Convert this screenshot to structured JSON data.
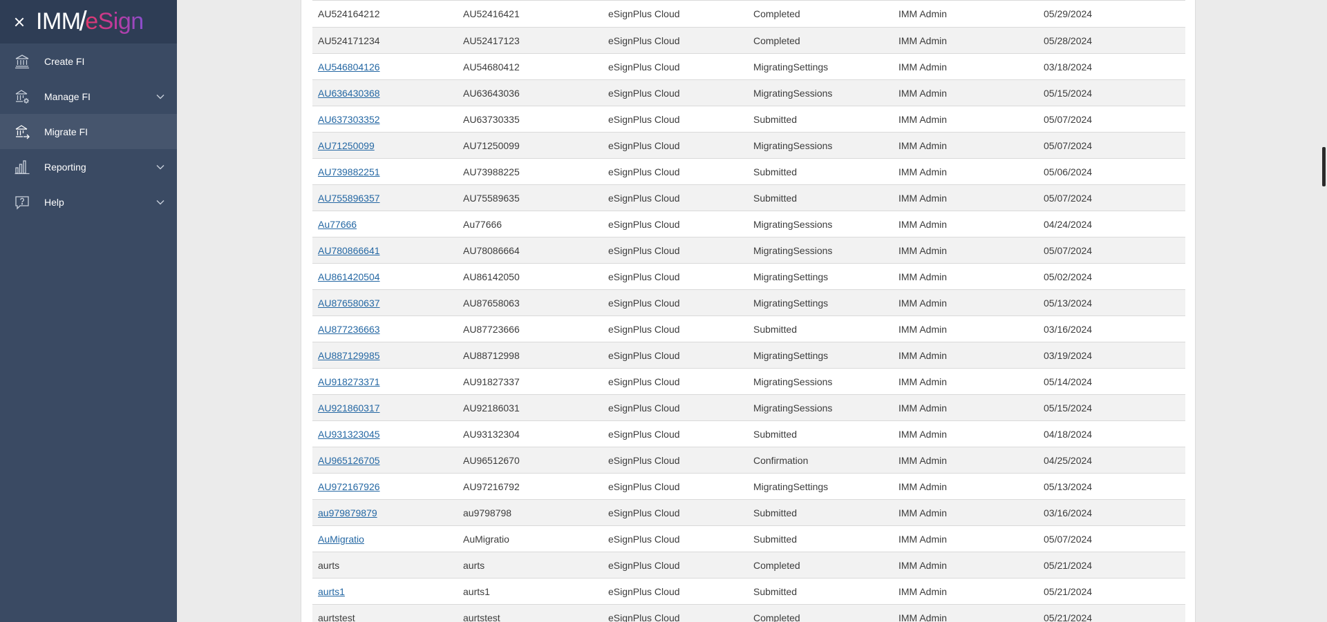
{
  "brand": {
    "logo_part1": "IMM",
    "logo_slash": "/",
    "logo_part2": "eSign"
  },
  "sidebar": {
    "items": [
      {
        "label": "Create FI",
        "icon": "bank-icon",
        "expandable": false,
        "active": false
      },
      {
        "label": "Manage FI",
        "icon": "bank-gear-icon",
        "expandable": true,
        "active": false
      },
      {
        "label": "Migrate FI",
        "icon": "bank-arrow-icon",
        "expandable": false,
        "active": true
      },
      {
        "label": "Reporting",
        "icon": "bar-chart-icon",
        "expandable": true,
        "active": false
      },
      {
        "label": "Help",
        "icon": "help-chat-icon",
        "expandable": true,
        "active": false
      }
    ]
  },
  "colors": {
    "sidebar_bg": "#3a4a63",
    "sidebar_brand_bg": "#2e3d55",
    "sidebar_active_bg": "#46556d",
    "link": "#2467a3",
    "row_alt": "#f2f2f2"
  },
  "table": {
    "rows": [
      {
        "id": "AU524164212",
        "link": false,
        "code": "AU52416421",
        "platform": "eSignPlus Cloud",
        "status": "Completed",
        "user": "IMM Admin",
        "date": "05/29/2024"
      },
      {
        "id": "AU524171234",
        "link": false,
        "code": "AU52417123",
        "platform": "eSignPlus Cloud",
        "status": "Completed",
        "user": "IMM Admin",
        "date": "05/28/2024"
      },
      {
        "id": "AU546804126",
        "link": true,
        "code": "AU54680412",
        "platform": "eSignPlus Cloud",
        "status": "MigratingSettings",
        "user": "IMM Admin",
        "date": "03/18/2024"
      },
      {
        "id": "AU636430368",
        "link": true,
        "code": "AU63643036",
        "platform": "eSignPlus Cloud",
        "status": "MigratingSessions",
        "user": "IMM Admin",
        "date": "05/15/2024"
      },
      {
        "id": "AU637303352",
        "link": true,
        "code": "AU63730335",
        "platform": "eSignPlus Cloud",
        "status": "Submitted",
        "user": "IMM Admin",
        "date": "05/07/2024"
      },
      {
        "id": "AU71250099",
        "link": true,
        "code": "AU71250099",
        "platform": "eSignPlus Cloud",
        "status": "MigratingSessions",
        "user": "IMM Admin",
        "date": "05/07/2024"
      },
      {
        "id": "AU739882251",
        "link": true,
        "code": "AU73988225",
        "platform": "eSignPlus Cloud",
        "status": "Submitted",
        "user": "IMM Admin",
        "date": "05/06/2024"
      },
      {
        "id": "AU755896357",
        "link": true,
        "code": "AU75589635",
        "platform": "eSignPlus Cloud",
        "status": "Submitted",
        "user": "IMM Admin",
        "date": "05/07/2024"
      },
      {
        "id": "Au77666",
        "link": true,
        "code": "Au77666",
        "platform": "eSignPlus Cloud",
        "status": "MigratingSessions",
        "user": "IMM Admin",
        "date": "04/24/2024"
      },
      {
        "id": "AU780866641",
        "link": true,
        "code": "AU78086664",
        "platform": "eSignPlus Cloud",
        "status": "MigratingSessions",
        "user": "IMM Admin",
        "date": "05/07/2024"
      },
      {
        "id": "AU861420504",
        "link": true,
        "code": "AU86142050",
        "platform": "eSignPlus Cloud",
        "status": "MigratingSettings",
        "user": "IMM Admin",
        "date": "05/02/2024"
      },
      {
        "id": "AU876580637",
        "link": true,
        "code": "AU87658063",
        "platform": "eSignPlus Cloud",
        "status": "MigratingSettings",
        "user": "IMM Admin",
        "date": "05/13/2024"
      },
      {
        "id": "AU877236663",
        "link": true,
        "code": "AU87723666",
        "platform": "eSignPlus Cloud",
        "status": "Submitted",
        "user": "IMM Admin",
        "date": "03/16/2024"
      },
      {
        "id": "AU887129985",
        "link": true,
        "code": "AU88712998",
        "platform": "eSignPlus Cloud",
        "status": "MigratingSettings",
        "user": "IMM Admin",
        "date": "03/19/2024"
      },
      {
        "id": "AU918273371",
        "link": true,
        "code": "AU91827337",
        "platform": "eSignPlus Cloud",
        "status": "MigratingSessions",
        "user": "IMM Admin",
        "date": "05/14/2024"
      },
      {
        "id": "AU921860317",
        "link": true,
        "code": "AU92186031",
        "platform": "eSignPlus Cloud",
        "status": "MigratingSessions",
        "user": "IMM Admin",
        "date": "05/15/2024"
      },
      {
        "id": "AU931323045",
        "link": true,
        "code": "AU93132304",
        "platform": "eSignPlus Cloud",
        "status": "Submitted",
        "user": "IMM Admin",
        "date": "04/18/2024"
      },
      {
        "id": "AU965126705",
        "link": true,
        "code": "AU96512670",
        "platform": "eSignPlus Cloud",
        "status": "Confirmation",
        "user": "IMM Admin",
        "date": "04/25/2024"
      },
      {
        "id": "AU972167926",
        "link": true,
        "code": "AU97216792",
        "platform": "eSignPlus Cloud",
        "status": "MigratingSettings",
        "user": "IMM Admin",
        "date": "05/13/2024"
      },
      {
        "id": "au979879879",
        "link": true,
        "code": "au9798798",
        "platform": "eSignPlus Cloud",
        "status": "Submitted",
        "user": "IMM Admin",
        "date": "03/16/2024"
      },
      {
        "id": "AuMigratio",
        "link": true,
        "code": "AuMigratio",
        "platform": "eSignPlus Cloud",
        "status": "Submitted",
        "user": "IMM Admin",
        "date": "05/07/2024"
      },
      {
        "id": "aurts",
        "link": false,
        "code": "aurts",
        "platform": "eSignPlus Cloud",
        "status": "Completed",
        "user": "IMM Admin",
        "date": "05/21/2024"
      },
      {
        "id": "aurts1",
        "link": true,
        "code": "aurts1",
        "platform": "eSignPlus Cloud",
        "status": "Submitted",
        "user": "IMM Admin",
        "date": "05/21/2024"
      },
      {
        "id": "aurtstest",
        "link": false,
        "code": "aurtstest",
        "platform": "eSignPlus Cloud",
        "status": "Completed",
        "user": "IMM Admin",
        "date": "05/21/2024"
      }
    ]
  }
}
